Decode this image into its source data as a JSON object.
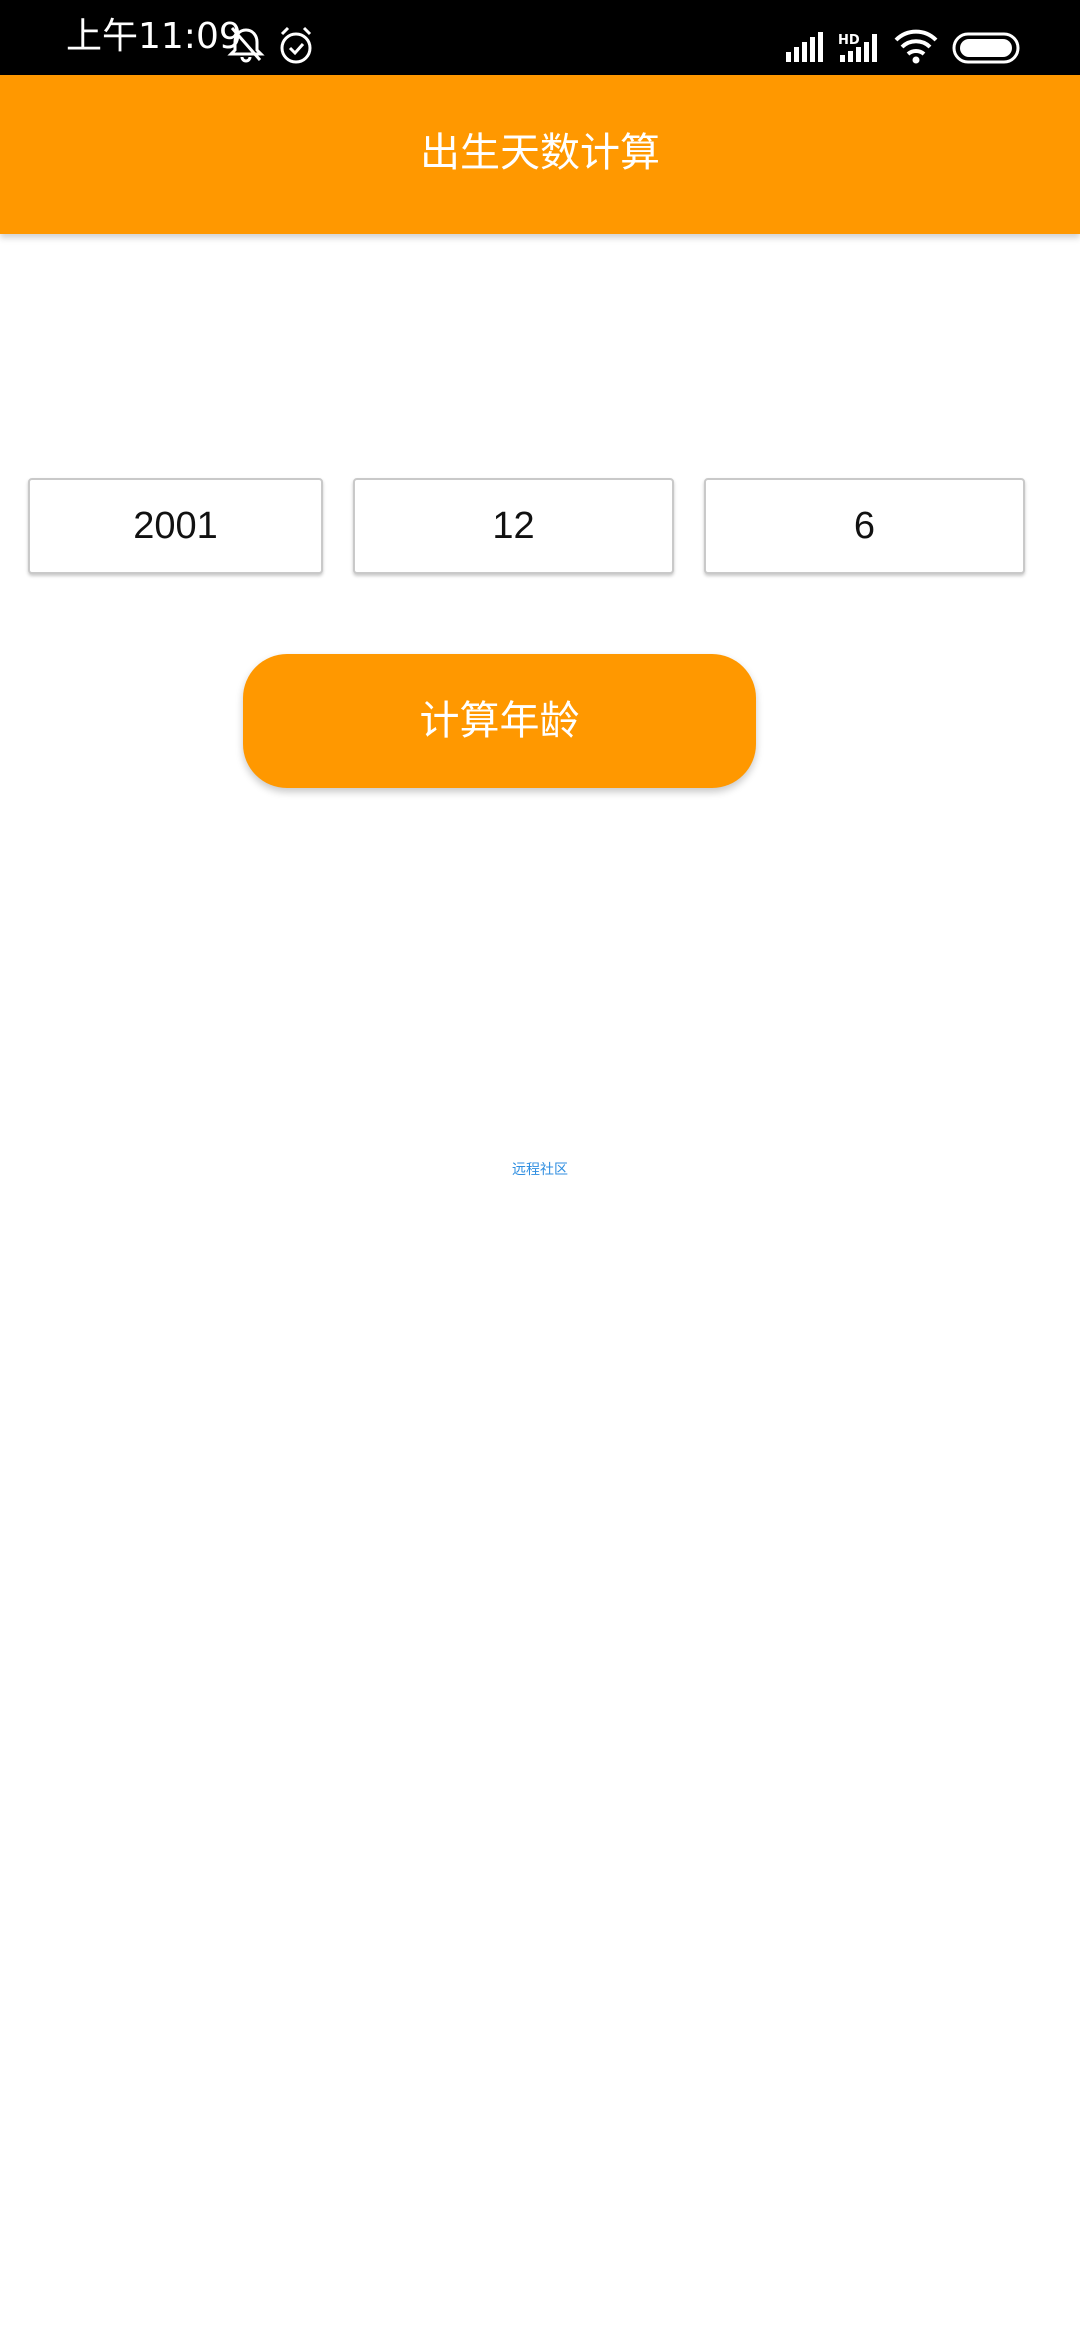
{
  "status_bar": {
    "time": "上午11:09",
    "icons": [
      "mute-bell-icon",
      "alarm-icon",
      "signal-icon",
      "hd-signal-icon",
      "wifi-icon",
      "battery-icon"
    ],
    "color": "#000000"
  },
  "app_bar": {
    "title": "出生天数计算",
    "color": "#FF9800"
  },
  "form": {
    "year": "2001",
    "month": "12",
    "day": "6",
    "button_label": "计算年龄",
    "button_color": "#FF9800"
  },
  "footer": {
    "link_text": "远程社区",
    "link_color": "#2f8ee0"
  }
}
